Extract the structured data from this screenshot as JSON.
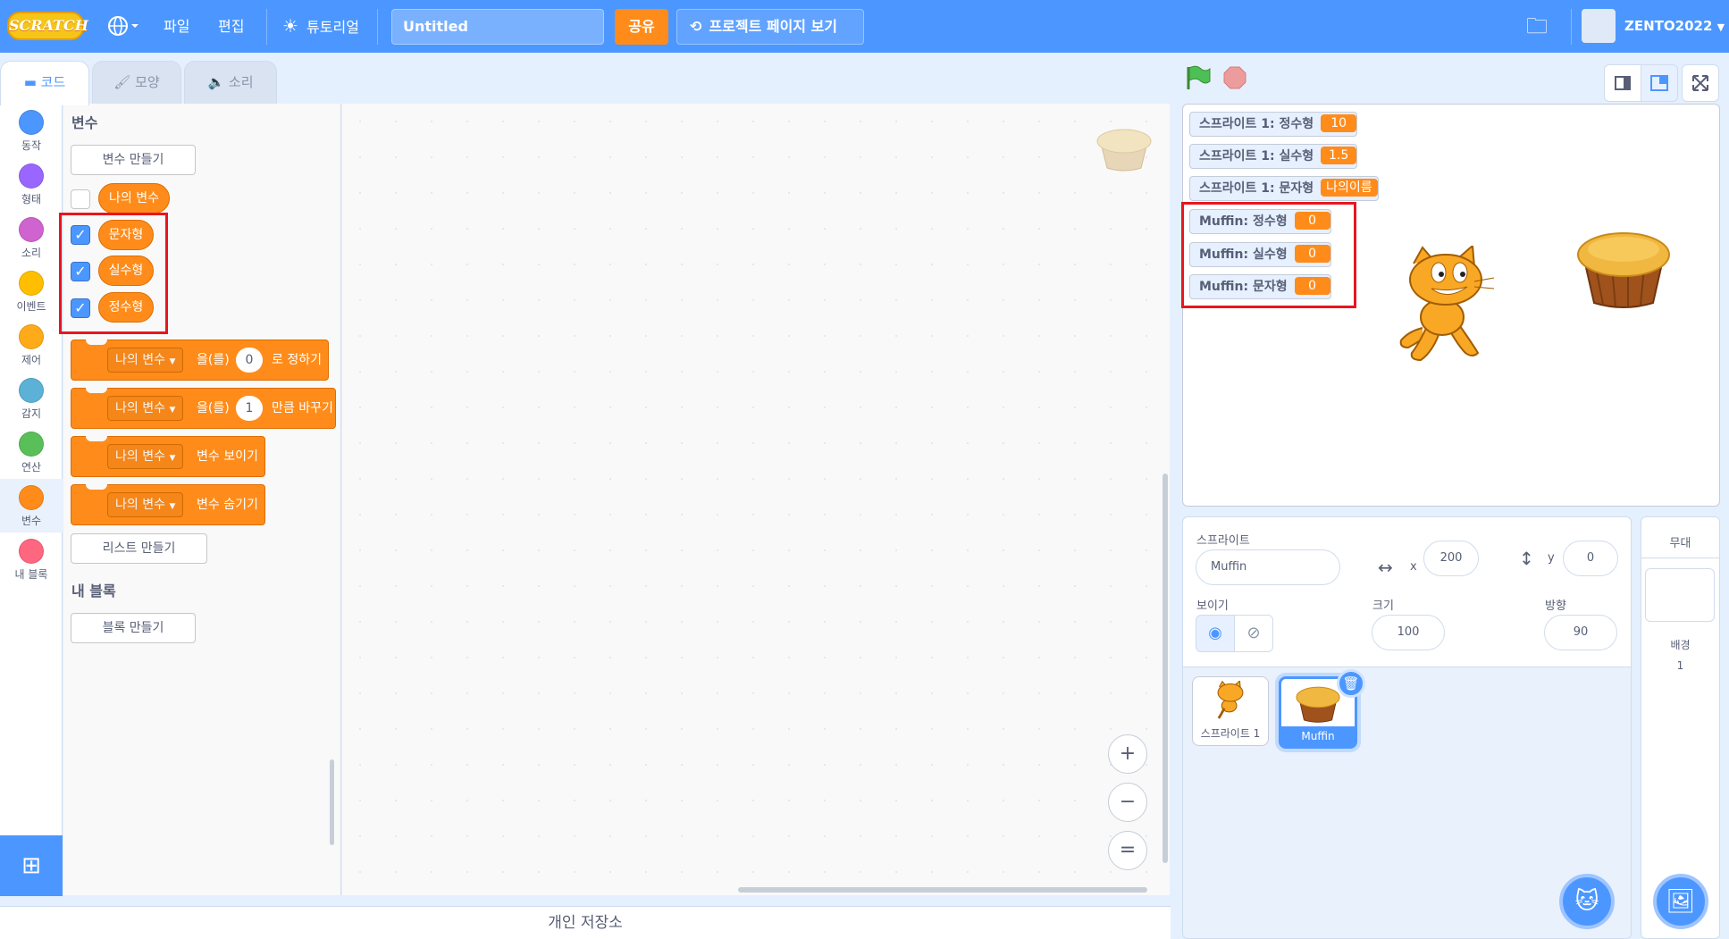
{
  "menu": {
    "logo": "SCRATCH",
    "file": "파일",
    "edit": "편집",
    "tutorial": "튜토리얼",
    "project_title": "Untitled",
    "share": "공유",
    "project_page": "프로젝트 페이지 보기",
    "username": "ZENTO2022"
  },
  "tabs": {
    "code": "코드",
    "costume": "모양",
    "sound": "소리"
  },
  "categories": [
    {
      "label": "동작",
      "color": "#4c97ff"
    },
    {
      "label": "형태",
      "color": "#9966ff"
    },
    {
      "label": "소리",
      "color": "#cf63cf"
    },
    {
      "label": "이벤트",
      "color": "#ffbf00"
    },
    {
      "label": "제어",
      "color": "#ffab19"
    },
    {
      "label": "감지",
      "color": "#5cb1d6"
    },
    {
      "label": "연산",
      "color": "#59c059"
    },
    {
      "label": "변수",
      "color": "#ff8c1a"
    },
    {
      "label": "내 블록",
      "color": "#ff6680"
    }
  ],
  "palette": {
    "variables_heading": "변수",
    "make_variable": "변수 만들기",
    "variables": [
      {
        "name": "나의 변수",
        "checked": false
      },
      {
        "name": "문자형",
        "checked": true
      },
      {
        "name": "실수형",
        "checked": true
      },
      {
        "name": "정수형",
        "checked": true
      }
    ],
    "blocks": {
      "set": {
        "var": "나의 변수",
        "mid": "을(를)",
        "value": "0",
        "end": "로 정하기"
      },
      "change": {
        "var": "나의 변수",
        "mid": "을(를)",
        "value": "1",
        "end": "만큼 바꾸기"
      },
      "show": {
        "var": "나의 변수",
        "end": "변수 보이기"
      },
      "hide": {
        "var": "나의 변수",
        "end": "변수 숨기기"
      }
    },
    "make_list": "리스트 만들기",
    "my_blocks_heading": "내 블록",
    "make_block": "블록 만들기"
  },
  "zoom": {
    "in": "+",
    "out": "−",
    "reset": "="
  },
  "backpack": "개인 저장소",
  "monitors": [
    {
      "label": "스프라이트 1: 정수형",
      "value": "10"
    },
    {
      "label": "스프라이트 1: 실수형",
      "value": "1.5"
    },
    {
      "label": "스프라이트 1: 문자형",
      "value": "나의이름"
    },
    {
      "label": "Muffin: 정수형",
      "value": "0"
    },
    {
      "label": "Muffin: 실수형",
      "value": "0"
    },
    {
      "label": "Muffin: 문자형",
      "value": "0"
    }
  ],
  "sprite_info": {
    "sprite_label": "스프라이트",
    "sprite_name": "Muffin",
    "x_label": "x",
    "x": "200",
    "y_label": "y",
    "y": "0",
    "show_label": "보이기",
    "size_label": "크기",
    "size": "100",
    "direction_label": "방향",
    "direction": "90"
  },
  "sprites": [
    {
      "name": "스프라이트 1",
      "selected": false
    },
    {
      "name": "Muffin",
      "selected": true
    }
  ],
  "stage_panel": {
    "title": "무대",
    "backdrop_label": "배경",
    "backdrop_count": "1"
  },
  "colors": {
    "accent": "#4c97ff",
    "variables": "#ff8c1a",
    "highlight": "#e8161e"
  }
}
